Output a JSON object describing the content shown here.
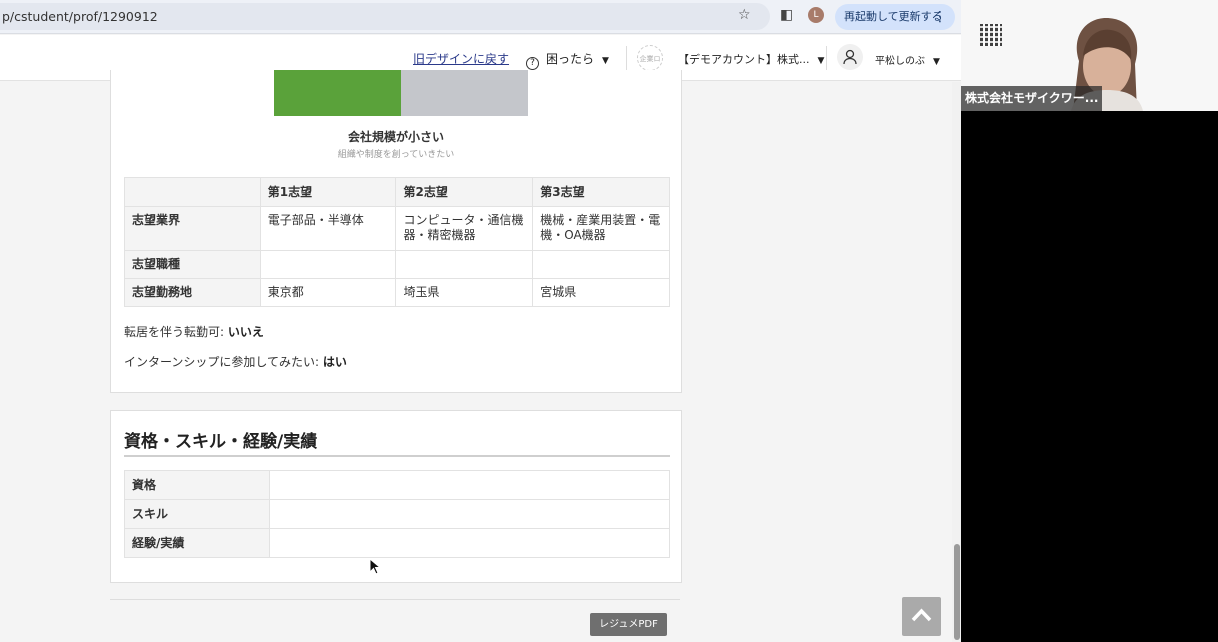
{
  "browser": {
    "url": "p/cstudent/prof/1290912",
    "avatar_letter": "L",
    "relaunch_label": "再起動して更新する",
    "menu_glyph": "⋮",
    "star_glyph": "☆",
    "sidepanel_glyph": "◧"
  },
  "header": {
    "back_old_design": "旧デザインに戻す",
    "help_label": "困ったら",
    "help_glyph": "?",
    "caret": "▼",
    "logo_text": "企業ロゴ",
    "account_label": "【デモアカウント】株式...",
    "user_label": "平松しのぶ"
  },
  "preference": {
    "scale_title": "会社規模が小さい",
    "scale_subtitle": "組織や制度を創っていきたい",
    "scale_level": 0.5,
    "table": {
      "columns": [
        "",
        "第1志望",
        "第2志望",
        "第3志望"
      ],
      "rows": [
        {
          "label": "志望業界",
          "values": [
            "電子部品・半導体",
            "コンピュータ・通信機器・精密機器",
            "機械・産業用装置・電機・OA機器"
          ]
        },
        {
          "label": "志望職種",
          "values": [
            "",
            "",
            ""
          ]
        },
        {
          "label": "志望勤務地",
          "values": [
            "東京都",
            "埼玉県",
            "宮城県"
          ]
        }
      ]
    },
    "relocation_label": "転居を伴う転勤可: ",
    "relocation_value": "いいえ",
    "internship_label": "インターンシップに参加してみたい: ",
    "internship_value": "はい"
  },
  "skills": {
    "title": "資格・スキル・経験/実績",
    "rows": [
      {
        "label": "資格",
        "value": ""
      },
      {
        "label": "スキル",
        "value": ""
      },
      {
        "label": "経験/実績",
        "value": ""
      }
    ]
  },
  "footer": {
    "resume_pdf_label": "レジュメPDF"
  },
  "video": {
    "participant_name": "株式会社モザイクワー..."
  },
  "colors": {
    "bar_green": "#5aa23a",
    "bar_gray": "#c4c6cb",
    "link_blue": "#2b3a8a",
    "relaunch_bg": "#d3e2fb"
  }
}
